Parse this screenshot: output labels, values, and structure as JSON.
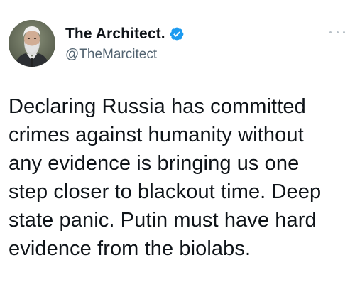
{
  "author": {
    "display_name": "The Architect.",
    "handle": "@TheMarcitect",
    "verified": true,
    "avatar": "profile-photo-older-man-white-hair-beard"
  },
  "menu": {
    "icon": "more-options-icon"
  },
  "tweet": {
    "text": "Declaring Russia has committed\ncrimes against humanity without\nany evidence is bringing us one\nstep closer to blackout time. Deep\nstate panic. Putin must have hard\nevidence from the biolabs."
  },
  "colors": {
    "verified_badge": "#1d9bf0",
    "text_primary": "#0f1419",
    "text_secondary": "#536471"
  }
}
